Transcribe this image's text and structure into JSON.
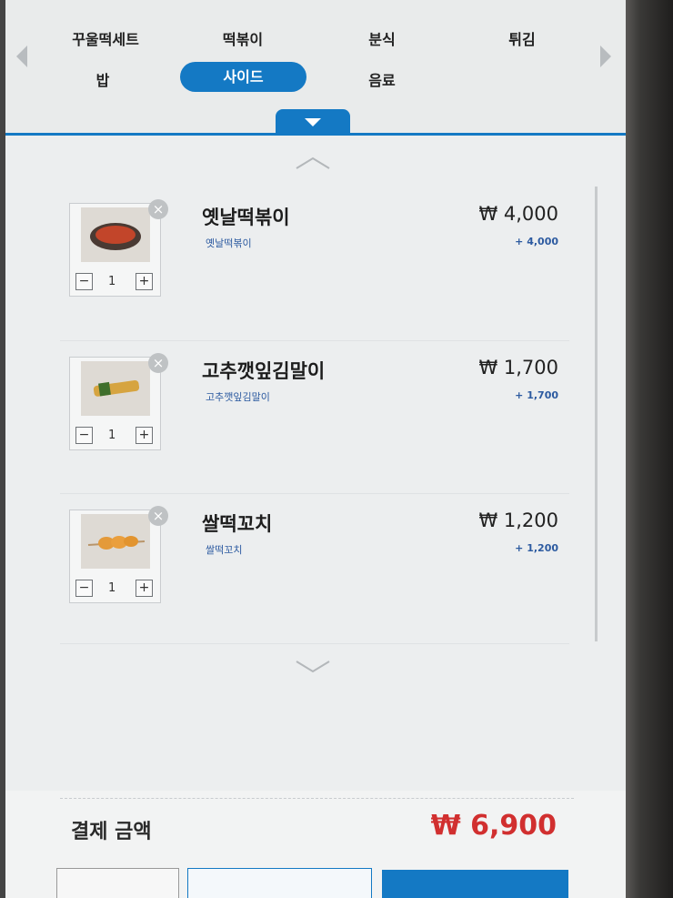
{
  "categories": {
    "row1": [
      "꾸울떡세트",
      "떡볶이",
      "분식",
      "튀김"
    ],
    "row2": [
      "밥",
      "사이드",
      "음료"
    ],
    "active": "사이드"
  },
  "cart": {
    "items": [
      {
        "name": "옛날떡볶이",
        "sub": "옛날떡볶이",
        "price": "₩ 4,000",
        "sub_price": "+ 4,000",
        "qty": "1"
      },
      {
        "name": "고추깻잎김말이",
        "sub": "고추깻잎김말이",
        "price": "₩ 1,700",
        "sub_price": "+ 1,700",
        "qty": "1"
      },
      {
        "name": "쌀떡꼬치",
        "sub": "쌀떡꼬치",
        "price": "₩ 1,200",
        "sub_price": "+ 1,200",
        "qty": "1"
      }
    ],
    "remove_symbol": "×",
    "minus_symbol": "−",
    "plus_symbol": "+"
  },
  "total": {
    "label": "결제 금액",
    "value": "₩ 6,900"
  },
  "colors": {
    "accent": "#1479c4",
    "total": "#d12f2f"
  }
}
